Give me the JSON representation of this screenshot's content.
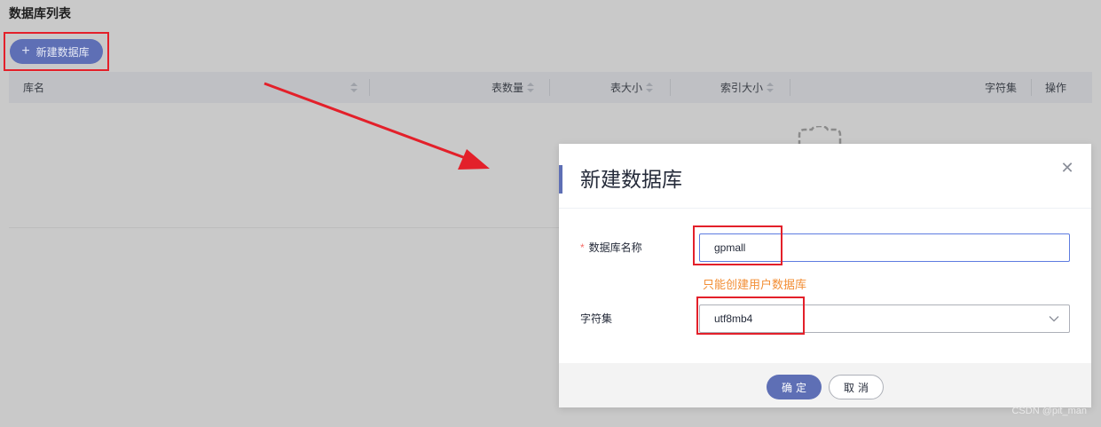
{
  "page": {
    "title": "数据库列表",
    "new_button_label": "新建数据库"
  },
  "table": {
    "columns": [
      {
        "label": "库名",
        "sortable": true
      },
      {
        "label": "表数量",
        "sortable": true
      },
      {
        "label": "表大小",
        "sortable": true
      },
      {
        "label": "索引大小",
        "sortable": true
      },
      {
        "label": "字符集",
        "sortable": false
      },
      {
        "label": "操作",
        "sortable": false
      }
    ]
  },
  "dialog": {
    "title": "新建数据库",
    "close_icon": "close-icon",
    "name_label": "数据库名称",
    "required_mark": "*",
    "name_value": "gpmall",
    "name_hint": "只能创建用户数据库",
    "charset_label": "字符集",
    "charset_value": "utf8mb4",
    "ok_label": "确定",
    "cancel_label": "取消"
  },
  "watermark": "CSDN @pit_man",
  "colors": {
    "accent": "#5e6fb5",
    "annotation_red": "#e3202a",
    "hint_orange": "#f28e35",
    "overlay_gray": "#c9c9c9"
  }
}
